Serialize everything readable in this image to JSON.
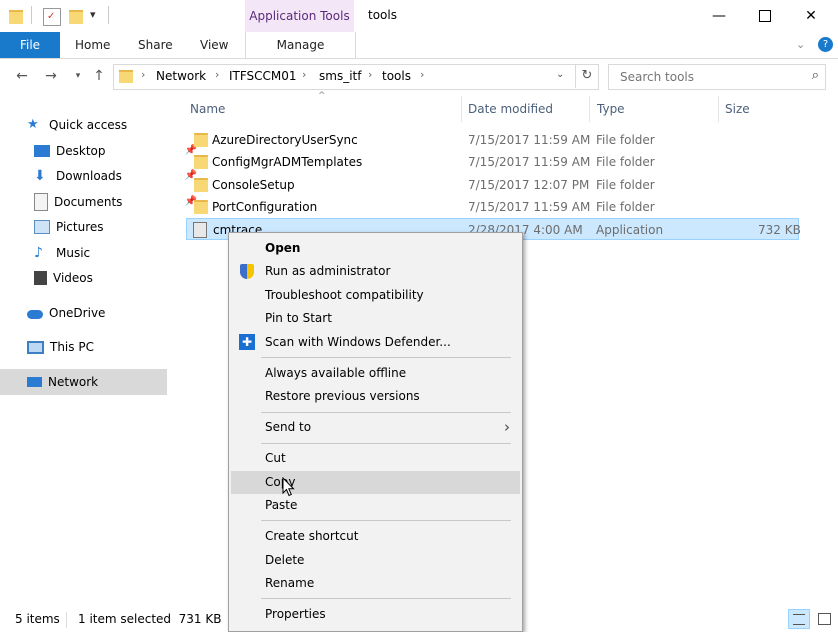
{
  "window": {
    "contextual_group": "Application Tools",
    "title": "tools",
    "minimize_icon": "minimize-icon",
    "maximize_icon": "maximize-icon",
    "close_icon": "close-icon"
  },
  "ribbon": {
    "tabs": [
      "File",
      "Home",
      "Share",
      "View"
    ],
    "contextual_tab": "Manage"
  },
  "address": {
    "breadcrumbs": [
      "Network",
      "ITFSCCM01",
      "sms_itf",
      "tools"
    ],
    "search_placeholder": "Search tools"
  },
  "nav": {
    "items": [
      {
        "label": "Quick access",
        "icon": "star-icon",
        "pinned": false
      },
      {
        "label": "Desktop",
        "icon": "desktop-icon",
        "pinned": true
      },
      {
        "label": "Downloads",
        "icon": "download-icon",
        "pinned": true
      },
      {
        "label": "Documents",
        "icon": "documents-icon",
        "pinned": true
      },
      {
        "label": "Pictures",
        "icon": "pictures-icon",
        "pinned": true
      },
      {
        "label": "Music",
        "icon": "music-icon",
        "pinned": false
      },
      {
        "label": "Videos",
        "icon": "videos-icon",
        "pinned": false
      },
      {
        "label": "OneDrive",
        "icon": "cloud-icon",
        "pinned": false
      },
      {
        "label": "This PC",
        "icon": "computer-icon",
        "pinned": false
      },
      {
        "label": "Network",
        "icon": "network-icon",
        "pinned": false
      }
    ],
    "selected": "Network"
  },
  "columns": [
    "Name",
    "Date modified",
    "Type",
    "Size"
  ],
  "files": [
    {
      "name": "AzureDirectoryUserSync",
      "date": "7/15/2017 11:59 AM",
      "type": "File folder",
      "size": ""
    },
    {
      "name": "ConfigMgrADMTemplates",
      "date": "7/15/2017 11:59 AM",
      "type": "File folder",
      "size": ""
    },
    {
      "name": "ConsoleSetup",
      "date": "7/15/2017 12:07 PM",
      "type": "File folder",
      "size": ""
    },
    {
      "name": "PortConfiguration",
      "date": "7/15/2017 11:59 AM",
      "type": "File folder",
      "size": ""
    },
    {
      "name": "cmtrace",
      "date": "2/28/2017 4:00 AM",
      "type": "Application",
      "size": "732 KB"
    }
  ],
  "context_menu": {
    "items": [
      {
        "label": "Open",
        "bold": true
      },
      {
        "label": "Run as administrator",
        "icon": "shield-icon"
      },
      {
        "label": "Troubleshoot compatibility"
      },
      {
        "label": "Pin to Start"
      },
      {
        "label": "Scan with Windows Defender...",
        "icon": "defender-icon"
      },
      {
        "label": "Always available offline"
      },
      {
        "label": "Restore previous versions"
      },
      {
        "label": "Send to",
        "submenu": true
      },
      {
        "label": "Cut"
      },
      {
        "label": "Copy",
        "highlighted": true
      },
      {
        "label": "Paste"
      },
      {
        "label": "Create shortcut"
      },
      {
        "label": "Delete"
      },
      {
        "label": "Rename"
      },
      {
        "label": "Properties"
      }
    ]
  },
  "status": {
    "item_count": "5 items",
    "selection": "1 item selected  731 KB"
  },
  "colors": {
    "accent": "#1979ca",
    "selection_bg": "#cce8ff",
    "selection_border": "#99d1ff",
    "nav_selected_bg": "#d9d9d9",
    "contextual_tab_bg": "#f3e6f7"
  }
}
